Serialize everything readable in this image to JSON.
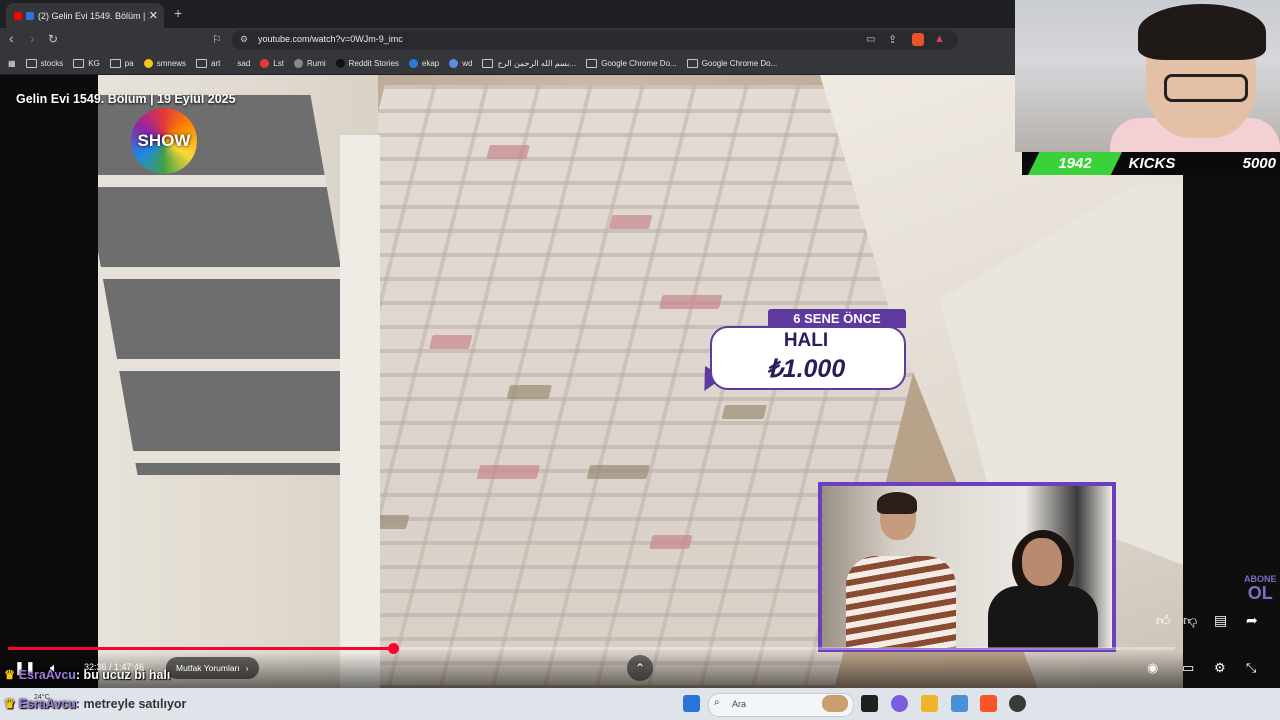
{
  "browser": {
    "tab_title": "(2) Gelin Evi 1549. Bölüm | 19",
    "tab_close": "✕",
    "new_tab": "+",
    "url": "youtube.com/watch?v=0WJm-9_imc",
    "bookmarks": [
      "stocks",
      "KG",
      "pa",
      "smnews",
      "art",
      "sad",
      "Lst",
      "Rumi",
      "Reddit Stories",
      "ekap",
      "wd",
      "بسم الله الرحمن الرح...",
      "Google Chrome Do...",
      "Google Chrome Do..."
    ]
  },
  "video": {
    "title": "Gelin Evi 1549. Bölüm | 19 Eylül 2025",
    "channel_logo": "SHOW",
    "price_tag": {
      "header": "6 SENE ÖNCE",
      "item": "HALI",
      "price": "₺1.000"
    },
    "subscribe_top": "ABONE",
    "subscribe_bottom": "OL"
  },
  "scoreboard": {
    "left": "1942",
    "middle": "KICKS",
    "right": "5000"
  },
  "player": {
    "time": "32:36 / 1:47:46",
    "chapter": "Mutfak Yorumları",
    "progress_fraction": 0.33
  },
  "chat": [
    {
      "user": "EsraAvcu",
      "message": ": bu ucuz bi halı"
    },
    {
      "user": "EsraAvcu",
      "message": ": metreyle satılıyor"
    }
  ],
  "taskbar": {
    "search_placeholder": "Ara",
    "weather": "24°C"
  },
  "icons": {
    "back": "arrow-left-icon",
    "forward": "arrow-right-icon",
    "reload": "reload-icon",
    "play": "pause-icon",
    "volume": "volume-icon"
  }
}
